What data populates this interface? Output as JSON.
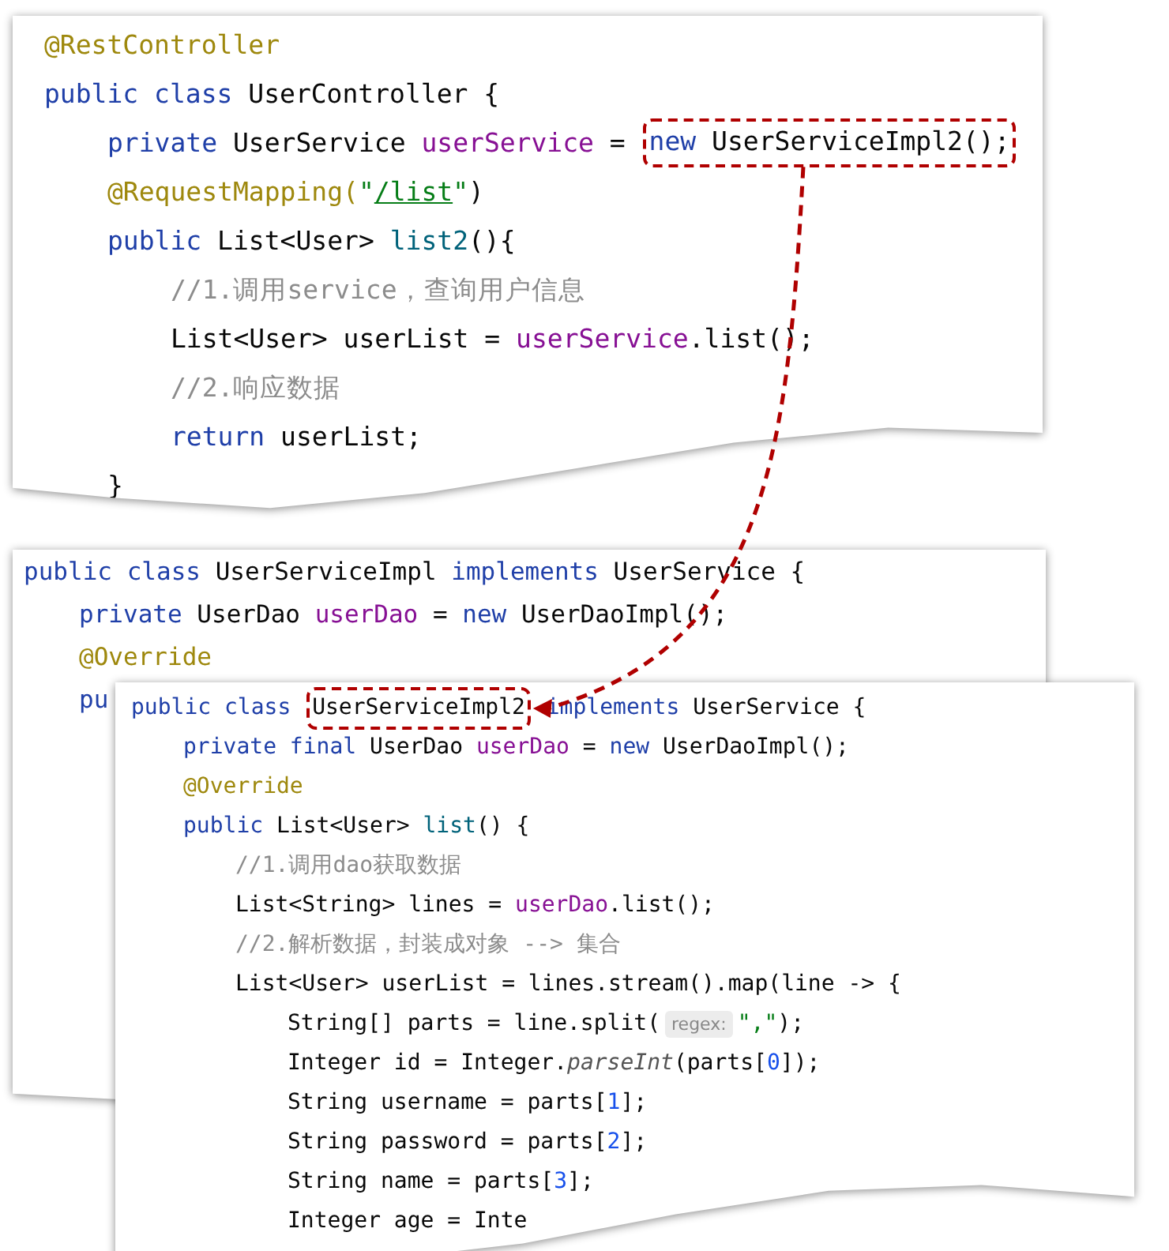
{
  "panels": [
    {
      "lines": [
        {
          "tokens": [
            {
              "text": "@RestController",
              "kind": "annotation"
            }
          ]
        },
        {
          "tokens": [
            {
              "text": "public class ",
              "kind": "keyword"
            },
            {
              "text": "UserController {",
              "kind": "plain"
            }
          ],
          "children": [
            {
              "tokens": [
                {
                  "text": "private ",
                  "kind": "keyword"
                },
                {
                  "text": "UserService ",
                  "kind": "plain"
                },
                {
                  "text": "userService",
                  "kind": "field"
                },
                {
                  "text": " = ",
                  "kind": "plain"
                },
                {
                  "kind": "highlight",
                  "tokens": [
                    {
                      "text": "new ",
                      "kind": "keyword"
                    },
                    {
                      "text": "UserServiceImpl2();",
                      "kind": "plain"
                    }
                  ]
                }
              ]
            },
            {
              "tokens": [
                {
                  "text": "@RequestMapping(",
                  "kind": "annotation"
                },
                {
                  "text": "\"",
                  "kind": "string"
                },
                {
                  "text": "/list",
                  "kind": "link"
                },
                {
                  "text": "\"",
                  "kind": "string"
                },
                {
                  "text": ")",
                  "kind": "plain"
                }
              ]
            },
            {
              "tokens": [
                {
                  "text": "public ",
                  "kind": "keyword"
                },
                {
                  "text": "List<User> ",
                  "kind": "plain"
                },
                {
                  "text": "list2",
                  "kind": "method"
                },
                {
                  "text": "(){",
                  "kind": "plain"
                }
              ],
              "children": [
                {
                  "tokens": [
                    {
                      "text": "//1.调用service，查询用户信息",
                      "kind": "comment"
                    }
                  ]
                },
                {
                  "tokens": [
                    {
                      "text": "List<User> userList = ",
                      "kind": "plain"
                    },
                    {
                      "text": "userService",
                      "kind": "field"
                    },
                    {
                      "text": ".list();",
                      "kind": "plain"
                    }
                  ]
                },
                {
                  "tokens": [
                    {
                      "text": "//2.响应数据",
                      "kind": "comment"
                    }
                  ]
                },
                {
                  "tokens": [
                    {
                      "text": "return ",
                      "kind": "keyword"
                    },
                    {
                      "text": "userList;",
                      "kind": "plain"
                    }
                  ]
                }
              ]
            },
            {
              "tokens": [
                {
                  "text": "}",
                  "kind": "plain"
                }
              ]
            }
          ]
        }
      ]
    },
    {
      "lines": [
        {
          "tokens": [
            {
              "text": "public class ",
              "kind": "keyword"
            },
            {
              "text": "UserServiceImpl ",
              "kind": "plain"
            },
            {
              "text": "implements ",
              "kind": "keyword"
            },
            {
              "text": "UserService {",
              "kind": "plain"
            }
          ],
          "children": [
            {
              "tokens": [
                {
                  "text": "private ",
                  "kind": "keyword"
                },
                {
                  "text": "UserDao ",
                  "kind": "plain"
                },
                {
                  "text": "userDao",
                  "kind": "field"
                },
                {
                  "text": " = ",
                  "kind": "plain"
                },
                {
                  "text": "new ",
                  "kind": "keyword"
                },
                {
                  "text": "UserDaoImpl();",
                  "kind": "plain"
                }
              ]
            },
            {
              "tokens": [
                {
                  "text": "@Override",
                  "kind": "annotation"
                }
              ]
            },
            {
              "tokens": [
                {
                  "text": "pu",
                  "kind": "keyword"
                }
              ]
            }
          ]
        }
      ]
    },
    {
      "lines": [
        {
          "tokens": [
            {
              "text": "public class ",
              "kind": "keyword"
            },
            {
              "kind": "highlight",
              "tokens": [
                {
                  "text": "UserServiceImpl2",
                  "kind": "plain"
                }
              ]
            },
            {
              "text": " implements ",
              "kind": "keyword"
            },
            {
              "text": "UserService {",
              "kind": "plain"
            }
          ],
          "children": [
            {
              "tokens": [
                {
                  "text": "private final ",
                  "kind": "keyword"
                },
                {
                  "text": "UserDao ",
                  "kind": "plain"
                },
                {
                  "text": "userDao",
                  "kind": "field"
                },
                {
                  "text": " = ",
                  "kind": "plain"
                },
                {
                  "text": "new ",
                  "kind": "keyword"
                },
                {
                  "text": "UserDaoImpl();",
                  "kind": "plain"
                }
              ]
            },
            {
              "tokens": [
                {
                  "text": "@Override",
                  "kind": "annotation"
                }
              ]
            },
            {
              "tokens": [
                {
                  "text": "public ",
                  "kind": "keyword"
                },
                {
                  "text": "List<User> ",
                  "kind": "plain"
                },
                {
                  "text": "list",
                  "kind": "method"
                },
                {
                  "text": "() {",
                  "kind": "plain"
                }
              ],
              "children": [
                {
                  "tokens": [
                    {
                      "text": "//1.调用dao获取数据",
                      "kind": "comment"
                    }
                  ]
                },
                {
                  "tokens": [
                    {
                      "text": "List<String> lines = ",
                      "kind": "plain"
                    },
                    {
                      "text": "userDao",
                      "kind": "field"
                    },
                    {
                      "text": ".list();",
                      "kind": "plain"
                    }
                  ]
                },
                {
                  "tokens": [
                    {
                      "text": "//2.解析数据，封装成对象 --> 集合",
                      "kind": "comment"
                    }
                  ]
                },
                {
                  "tokens": [
                    {
                      "text": "List<User> userList = lines.stream().map(line -> {",
                      "kind": "plain"
                    }
                  ],
                  "children": [
                    {
                      "tokens": [
                        {
                          "text": "String[] parts = line.split(",
                          "kind": "plain"
                        },
                        {
                          "text": "regex:",
                          "kind": "hint"
                        },
                        {
                          "text": "\",\"",
                          "kind": "string"
                        },
                        {
                          "text": ");",
                          "kind": "plain"
                        }
                      ]
                    },
                    {
                      "tokens": [
                        {
                          "text": "Integer id = Integer.",
                          "kind": "plain"
                        },
                        {
                          "text": "parseInt",
                          "kind": "italic"
                        },
                        {
                          "text": "(parts[",
                          "kind": "plain"
                        },
                        {
                          "text": "0",
                          "kind": "number"
                        },
                        {
                          "text": "]);",
                          "kind": "plain"
                        }
                      ]
                    },
                    {
                      "tokens": [
                        {
                          "text": "String username = parts[",
                          "kind": "plain"
                        },
                        {
                          "text": "1",
                          "kind": "number"
                        },
                        {
                          "text": "];",
                          "kind": "plain"
                        }
                      ]
                    },
                    {
                      "tokens": [
                        {
                          "text": "String password = parts[",
                          "kind": "plain"
                        },
                        {
                          "text": "2",
                          "kind": "number"
                        },
                        {
                          "text": "];",
                          "kind": "plain"
                        }
                      ]
                    },
                    {
                      "tokens": [
                        {
                          "text": "String name = parts[",
                          "kind": "plain"
                        },
                        {
                          "text": "3",
                          "kind": "number"
                        },
                        {
                          "text": "];",
                          "kind": "plain"
                        }
                      ]
                    },
                    {
                      "tokens": [
                        {
                          "text": "Integer age = Inte",
                          "kind": "plain"
                        }
                      ]
                    }
                  ]
                }
              ]
            }
          ]
        }
      ]
    }
  ]
}
